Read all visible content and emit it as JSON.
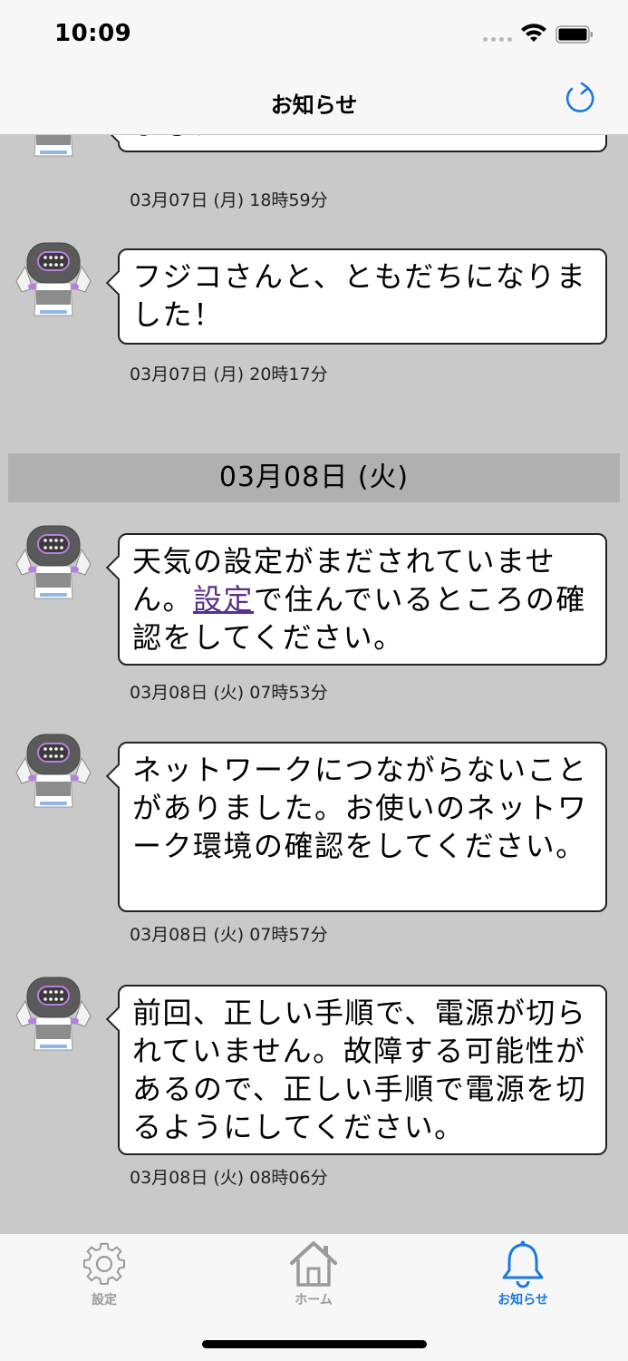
{
  "status": {
    "time": "10:09"
  },
  "nav": {
    "title": "お知らせ"
  },
  "messages": [
    {
      "text": "ました！",
      "timestamp": "03月07日 (月) 18時59分"
    },
    {
      "text": "フジコさんと、ともだちになりました！",
      "timestamp": "03月07日 (月) 20時17分"
    },
    {
      "text_before": "天気の設定がまだされていません。",
      "link": "設定",
      "text_after": "で住んでいるところの確認をしてください。",
      "timestamp": "03月08日 (火) 07時53分"
    },
    {
      "text": "ネットワークにつながらないことがありました。お使いのネットワーク環境の確認をしてください。",
      "timestamp": "03月08日 (火) 07時57分"
    },
    {
      "text": "前回、正しい手順で、電源が切られていません。故障する可能性があるので、正しい手順で電源を切るようにしてください。",
      "timestamp": "03月08日 (火) 08時06分"
    }
  ],
  "date_header": "03月08日 (火)",
  "tabs": [
    {
      "label": "設定",
      "icon": "gear-icon",
      "active": false
    },
    {
      "label": "ホーム",
      "icon": "home-icon",
      "active": false
    },
    {
      "label": "お知らせ",
      "icon": "bell-icon",
      "active": true
    }
  ],
  "colors": {
    "accent": "#1a7ae0",
    "content_bg": "#c9c9c9",
    "date_header_bg": "#b0b0b0",
    "link": "#5a2f8a"
  }
}
